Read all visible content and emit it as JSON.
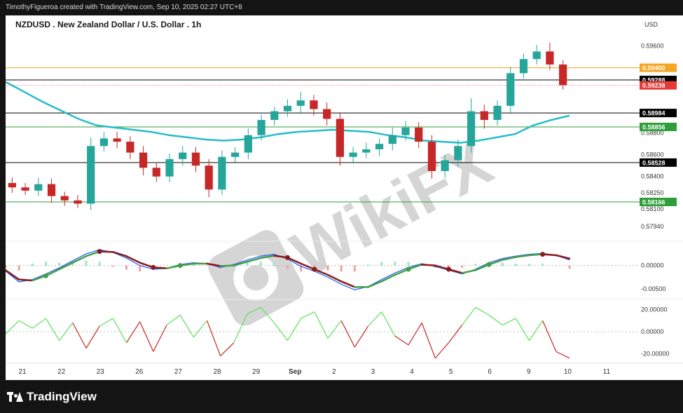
{
  "header": {
    "attribution": "TimothyFigueroa created with TradingView.com, Sep 10, 2025 02:27 UTC+8"
  },
  "brand": {
    "name": "TradingView"
  },
  "watermark": {
    "text": "WikiFX"
  },
  "chart_data": {
    "type": "line",
    "title": "NZDUSD . New Zealand Dollar / U.S. Dollar . 1h",
    "currency_label": "USD",
    "price_axis": {
      "ticks": [
        0.596,
        0.588,
        0.586,
        0.584,
        0.5825,
        0.581,
        0.5794
      ],
      "tick_labels": [
        "0.59600",
        "0.58800",
        "0.58600",
        "0.58400",
        "0.58250",
        "0.58100",
        "0.57940"
      ]
    },
    "time_axis": {
      "labels": [
        "21",
        "22",
        "23",
        "26",
        "27",
        "28",
        "29",
        "Sep",
        "2",
        "3",
        "4",
        "5",
        "6",
        "9",
        "10",
        "11"
      ]
    },
    "horizontal_levels": [
      {
        "value": 0.594,
        "label": "0.59400",
        "color": "#f5a623"
      },
      {
        "value": 0.59288,
        "label": "0.59288",
        "color": "#000000"
      },
      {
        "value": 0.58984,
        "label": "0.58984",
        "color": "#000000"
      },
      {
        "value": 0.58856,
        "label": "0.58856",
        "color": "#2e9e3a"
      },
      {
        "value": 0.58528,
        "label": "0.58528",
        "color": "#000000"
      },
      {
        "value": 0.58166,
        "label": "0.58166",
        "color": "#2e9e3a"
      }
    ],
    "last_price": {
      "value": 0.59238,
      "label": "0.59238",
      "color": "#e53935"
    },
    "moving_average": {
      "color": "#26bcc9",
      "values": [
        0.5927,
        0.5918,
        0.5909,
        0.5901,
        0.5893,
        0.5887,
        0.5885,
        0.5883,
        0.5881,
        0.5878,
        0.5876,
        0.5874,
        0.5873,
        0.5874,
        0.5876,
        0.5879,
        0.5881,
        0.5882,
        0.5883,
        0.5882,
        0.5881,
        0.5878,
        0.5876,
        0.5873,
        0.5872,
        0.5871,
        0.5873,
        0.5876,
        0.5879,
        0.5887,
        0.5892,
        0.5896
      ]
    },
    "candles": {
      "up_color": "#26a69a",
      "down_color": "#c62828",
      "close": [
        0.583,
        0.5827,
        0.5833,
        0.5822,
        0.5818,
        0.5815,
        0.5868,
        0.5875,
        0.5872,
        0.5862,
        0.5848,
        0.584,
        0.5856,
        0.5862,
        0.585,
        0.5828,
        0.5858,
        0.5862,
        0.5878,
        0.5892,
        0.59,
        0.5905,
        0.591,
        0.5902,
        0.5893,
        0.5858,
        0.5862,
        0.5865,
        0.587,
        0.5878,
        0.5885,
        0.5872,
        0.5845,
        0.5855,
        0.5868,
        0.59,
        0.5892,
        0.5905,
        0.5935,
        0.5948,
        0.5955,
        0.5943,
        0.5924
      ],
      "high_offset": [
        0.0005,
        0.0004,
        0.0006,
        0.0005,
        0.0004,
        0.0005,
        0.0008,
        0.0006,
        0.0006,
        0.0005,
        0.0006,
        0.0005,
        0.0005,
        0.0006,
        0.0005,
        0.0006,
        0.0006,
        0.0005,
        0.0006,
        0.0005,
        0.0004,
        0.0006,
        0.0008,
        0.0005,
        0.0006,
        0.0006,
        0.0005,
        0.0006,
        0.0005,
        0.0007,
        0.0006,
        0.0005,
        0.0006,
        0.0005,
        0.0006,
        0.0012,
        0.0006,
        0.0005,
        0.0006,
        0.0005,
        0.0006,
        0.0008,
        0.0004
      ],
      "low_offset": [
        0.0005,
        0.0004,
        0.0005,
        0.0006,
        0.0005,
        0.0004,
        0.0006,
        0.0005,
        0.0006,
        0.0006,
        0.0007,
        0.0005,
        0.0005,
        0.0006,
        0.0006,
        0.0007,
        0.0005,
        0.0005,
        0.0006,
        0.0005,
        0.0005,
        0.0005,
        0.0006,
        0.0006,
        0.0006,
        0.0008,
        0.0006,
        0.0005,
        0.0006,
        0.0006,
        0.0005,
        0.0006,
        0.0007,
        0.0006,
        0.0006,
        0.0006,
        0.0008,
        0.0005,
        0.0006,
        0.0005,
        0.0005,
        0.0005,
        0.0004
      ]
    },
    "macd": {
      "tick_labels": [
        "0.00000",
        "-0.00500"
      ],
      "tick_values": [
        0,
        -0.005
      ],
      "macd_color": "#2962ff",
      "signal_up_color": "#43a047",
      "signal_down_color": "#8b1a1a",
      "macd": [
        -0.0012,
        -0.0035,
        -0.003,
        -0.0018,
        -0.0005,
        0.001,
        0.0025,
        0.0034,
        0.0028,
        0.0016,
        0.0,
        -0.0008,
        -0.0006,
        0.0002,
        0.0006,
        0.0004,
        -0.0004,
        0.0002,
        0.0012,
        0.002,
        0.0024,
        0.0014,
        -0.0002,
        -0.0012,
        -0.0025,
        -0.004,
        -0.0052,
        -0.0045,
        -0.003,
        -0.0016,
        -0.0004,
        0.0004,
        -0.0002,
        -0.001,
        -0.0018,
        -0.0008,
        0.0006,
        0.0015,
        0.002,
        0.0024,
        0.0026,
        0.0022,
        0.0012
      ],
      "signal": [
        -0.001,
        -0.003,
        -0.0032,
        -0.0022,
        -0.0008,
        0.0006,
        0.002,
        0.003,
        0.0029,
        0.002,
        0.0006,
        -0.0004,
        -0.0006,
        0.0,
        0.0004,
        0.0004,
        -0.0001,
        0.0,
        0.0008,
        0.0016,
        0.0021,
        0.0017,
        0.0004,
        -0.0008,
        -0.002,
        -0.0034,
        -0.0046,
        -0.0046,
        -0.0034,
        -0.002,
        -0.0008,
        0.0002,
        0.0,
        -0.0008,
        -0.0016,
        -0.001,
        0.0002,
        0.0012,
        0.0018,
        0.0022,
        0.0024,
        0.0022,
        0.0015
      ],
      "cross_indices": [
        3,
        7,
        11,
        13,
        21,
        23,
        30,
        33,
        36,
        40
      ]
    },
    "oscillator": {
      "tick_labels": [
        "20.00000",
        "0.00000",
        "-20.00000"
      ],
      "tick_values": [
        20,
        0,
        -20
      ],
      "up_color": "#5be15b",
      "down_color": "#c62828",
      "values": [
        -2,
        10,
        3,
        12,
        -8,
        8,
        -15,
        5,
        12,
        -10,
        9,
        -18,
        6,
        15,
        -5,
        10,
        -22,
        -10,
        16,
        22,
        8,
        -8,
        12,
        18,
        -6,
        10,
        -14,
        5,
        18,
        -4,
        -12,
        8,
        -24,
        -10,
        6,
        22,
        15,
        6,
        12,
        -8,
        10,
        -18,
        -24
      ]
    }
  }
}
